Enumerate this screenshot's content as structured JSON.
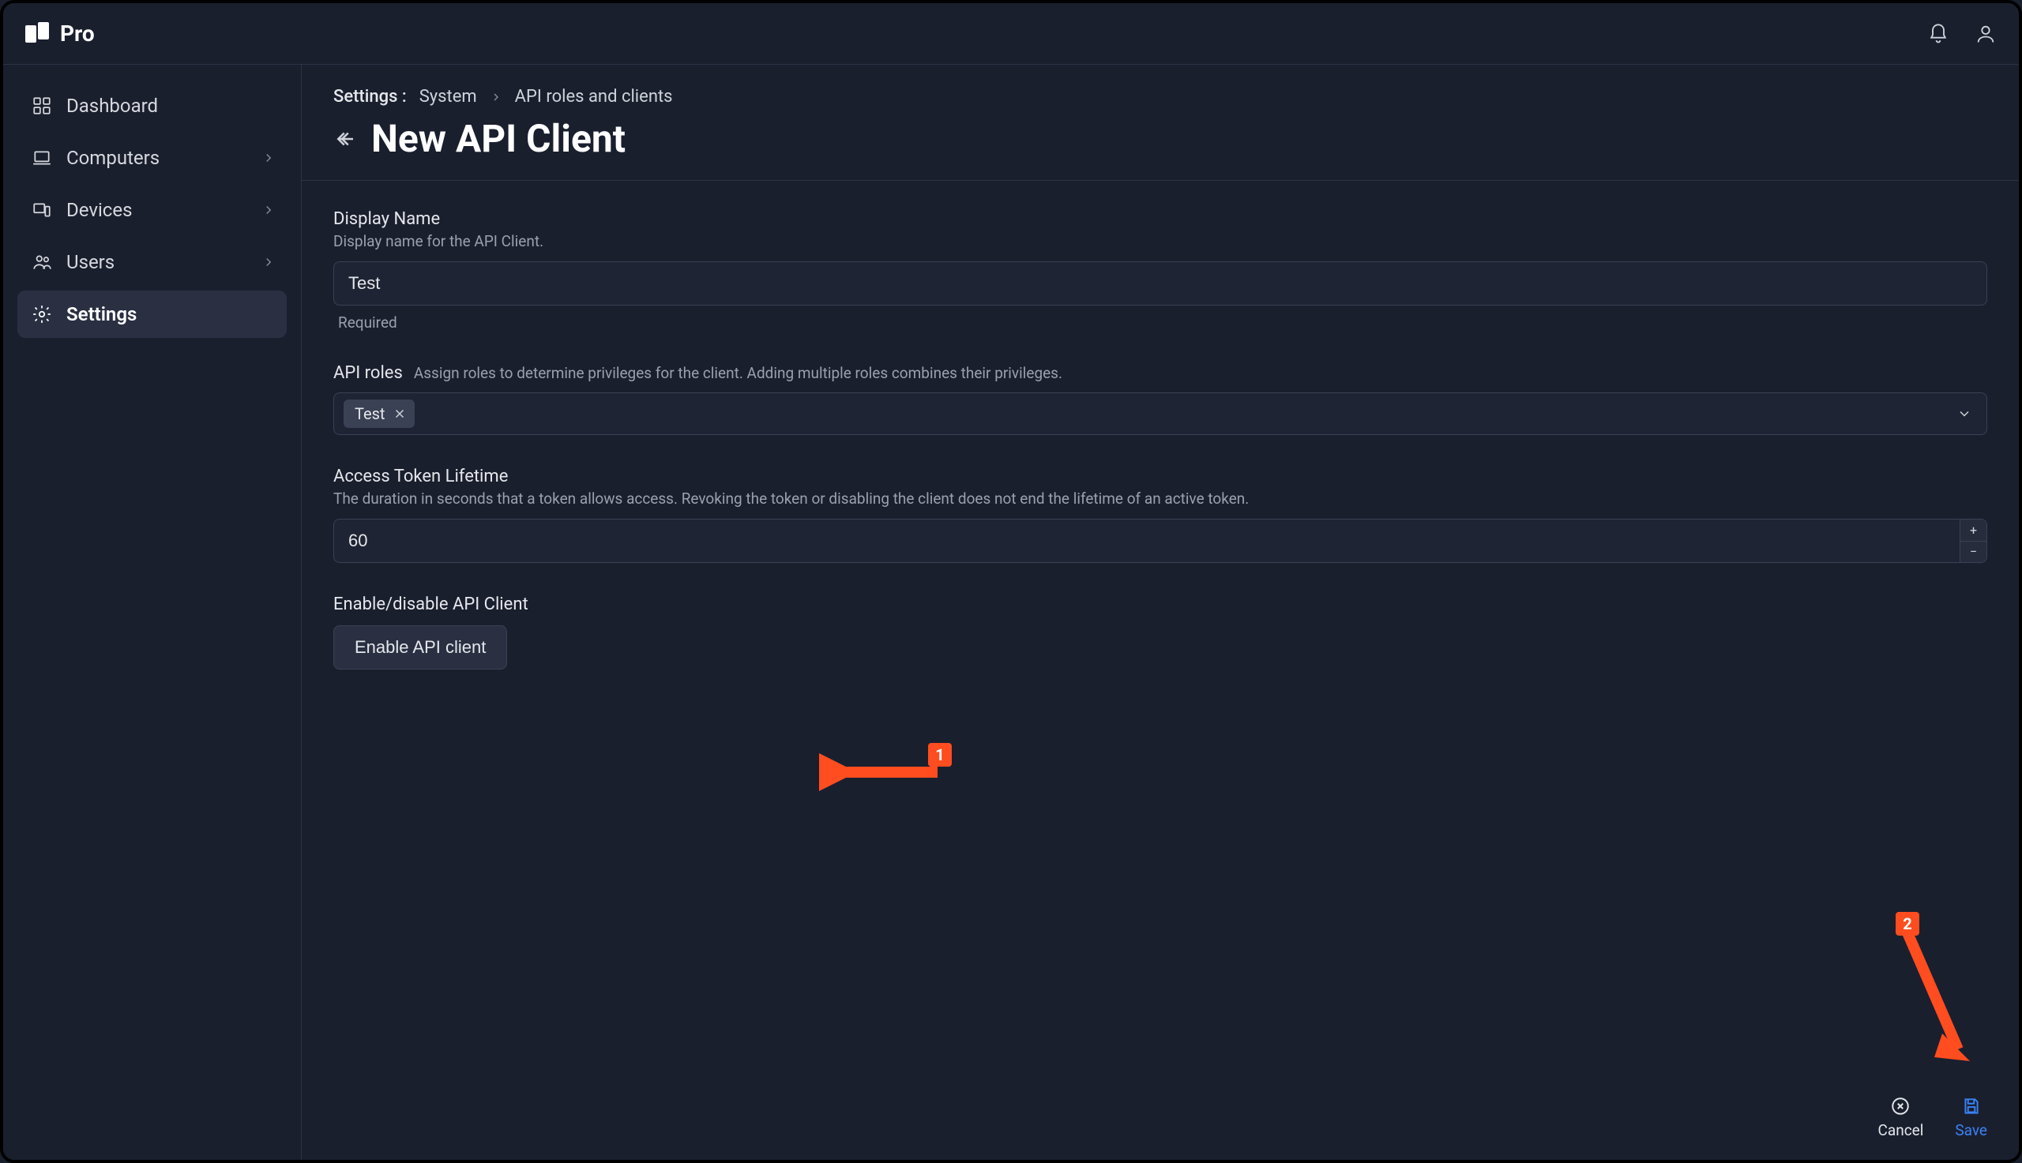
{
  "brand": {
    "name": "Pro"
  },
  "topbar": {
    "notification_icon": "bell-icon",
    "user_icon": "user-icon"
  },
  "sidebar": {
    "items": [
      {
        "label": "Dashboard",
        "icon": "dashboard-icon",
        "has_children": false,
        "active": false
      },
      {
        "label": "Computers",
        "icon": "laptop-icon",
        "has_children": true,
        "active": false
      },
      {
        "label": "Devices",
        "icon": "devices-icon",
        "has_children": true,
        "active": false
      },
      {
        "label": "Users",
        "icon": "users-icon",
        "has_children": true,
        "active": false
      },
      {
        "label": "Settings",
        "icon": "gear-icon",
        "has_children": false,
        "active": true
      }
    ]
  },
  "breadcrumbs": {
    "prefix": "Settings :",
    "items": [
      "System",
      "API roles and clients"
    ]
  },
  "page": {
    "title": "New API Client"
  },
  "form": {
    "display_name": {
      "label": "Display Name",
      "sub": "Display name for the API Client.",
      "value": "Test",
      "helper": "Required"
    },
    "api_roles": {
      "label": "API roles",
      "sub": "Assign roles to determine privileges for the client. Adding multiple roles combines their privileges.",
      "selected": [
        "Test"
      ]
    },
    "token_lifetime": {
      "label": "Access Token Lifetime",
      "sub": "The duration in seconds that a token allows access. Revoking the token or disabling the client does not end the lifetime of an active token.",
      "value": "60"
    },
    "enable_section": {
      "label": "Enable/disable API Client",
      "button": "Enable API client"
    }
  },
  "footer": {
    "cancel": "Cancel",
    "save": "Save"
  },
  "annotations": {
    "badge1": "1",
    "badge2": "2"
  },
  "colors": {
    "accent": "#3b82f6",
    "annotation": "#ff4d1f",
    "bg": "#1a1f2e"
  }
}
